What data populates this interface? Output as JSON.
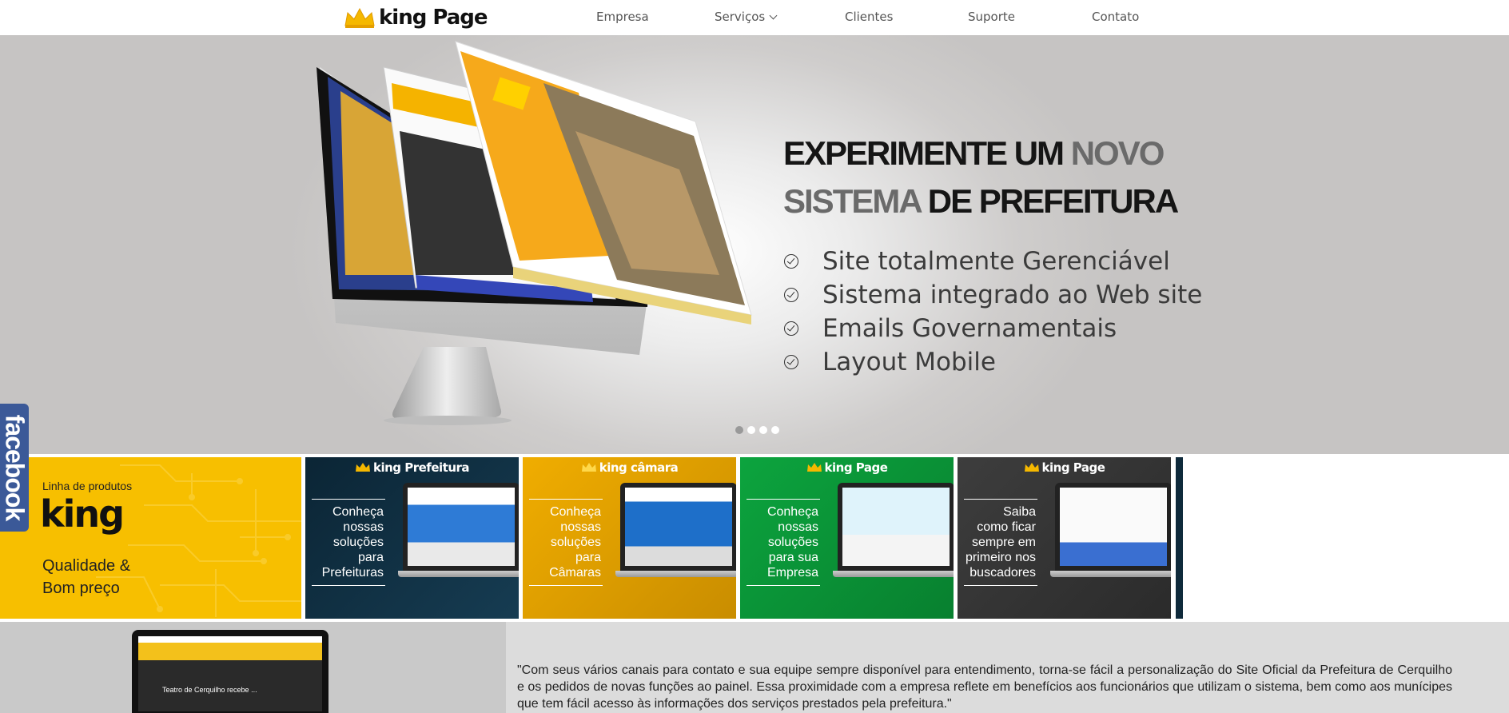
{
  "header": {
    "logo_text": "king Page",
    "nav": [
      {
        "label": "Empresa"
      },
      {
        "label": "Serviços"
      },
      {
        "label": "Clientes"
      },
      {
        "label": "Suporte"
      },
      {
        "label": "Contato"
      }
    ]
  },
  "hero": {
    "headline": {
      "part1": "EXPERIMENTE UM ",
      "part2": "NOVO",
      "part3": "SISTEMA",
      "part4": " DE PREFEITURA"
    },
    "features": [
      "Site totalmente Gerenciável",
      "Sistema integrado ao Web site",
      "Emails Governamentais",
      "Layout Mobile"
    ],
    "slides": 4,
    "active_slide": 1
  },
  "facebook_tab": {
    "label": "facebook",
    "color": "#3b5998"
  },
  "products": {
    "intro": {
      "small": "Linha de produtos",
      "brand": "king",
      "tagline_1": "Qualidade &",
      "tagline_2": "Bom preço",
      "color": "#f7bf00"
    },
    "cards": [
      {
        "brand": "king Prefeitura",
        "lines": [
          "Conheça",
          "nossas",
          "soluções",
          "para",
          "Prefeituras"
        ],
        "color": "#0f2a3b"
      },
      {
        "brand": "king câmara",
        "lines": [
          "Conheça",
          "nossas",
          "soluções",
          "para",
          "Câmaras"
        ],
        "color": "#e6a600"
      },
      {
        "brand": "king Page",
        "lines": [
          "Conheça",
          "nossas",
          "soluções",
          "para sua",
          "Empresa"
        ],
        "color": "#0c9a3a"
      },
      {
        "brand": "king Page",
        "lines": [
          "Saiba",
          "como ficar",
          "sempre em",
          "primeiro nos",
          "buscadores"
        ],
        "color": "#3a3a3a"
      }
    ]
  },
  "testimonial": {
    "quote": "\"Com seus vários canais para contato e sua equipe sempre disponível para entendimento, torna-se fácil a personalização do Site Oficial da Prefeitura de Cerquilho e os pedidos de novas funções ao painel. Essa proximidade com a empresa reflete em benefícios aos funcionários que utilizam o sistema, bem como aos munícipes que tem fácil acesso às informações dos serviços prestados pela prefeitura.\"",
    "screen_caption": "Teatro de Cerquilho recebe ..."
  },
  "colors": {
    "accent_yellow": "#f7bf00",
    "facebook_blue": "#3b5998"
  }
}
